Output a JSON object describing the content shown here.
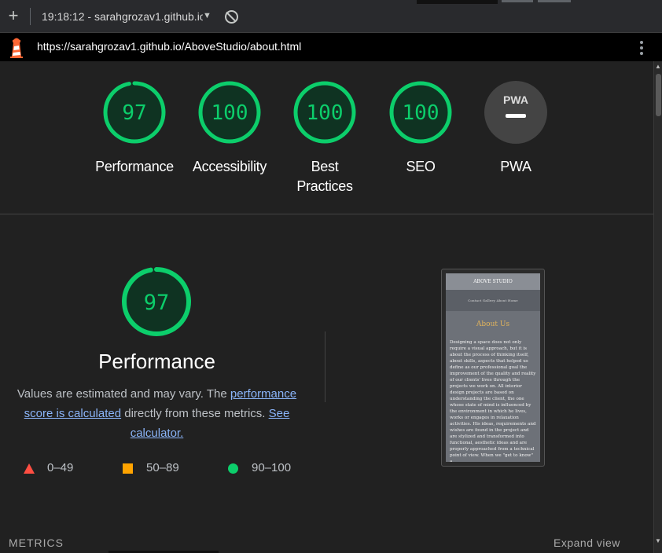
{
  "toolbar": {
    "report_selector": "19:18:12 - sarahgrozav1.github.io",
    "new_report_glyph": "+",
    "clear_glyph": "block-icon"
  },
  "urlbar": {
    "url": "https://sarahgrozav1.github.io/AboveStudio/about.html"
  },
  "gauges": [
    {
      "label": "Performance",
      "score": "97",
      "fraction": 0.97
    },
    {
      "label": "Accessibility",
      "score": "100",
      "fraction": 1.0
    },
    {
      "label": "Best Practices",
      "score": "100",
      "fraction": 1.0
    },
    {
      "label": "SEO",
      "score": "100",
      "fraction": 1.0
    },
    {
      "label": "PWA",
      "score": "PWA",
      "fraction": 0
    }
  ],
  "performance": {
    "score": "97",
    "fraction": 0.97,
    "title": "Performance",
    "desc_pre": "Values are estimated and may vary. The ",
    "link1": "performance score is calculated",
    "desc_mid": " directly from these metrics. ",
    "link2": "See calculator."
  },
  "legend": [
    {
      "range": "0–49",
      "shape": "triangle",
      "color": "#ff4e42"
    },
    {
      "range": "50–89",
      "shape": "square",
      "color": "#ffa400"
    },
    {
      "range": "90–100",
      "shape": "circle",
      "color": "#0cce6b"
    }
  ],
  "preview": {
    "brand": "ABOVE STUDIO",
    "nav": "Contact   Gallery   About   Home",
    "heading": "About Us",
    "body": "Designing a space does not only require a visual approach, but it is about the process of thinking itself, about skills, aspects that helped us define as our professional goal the improvement of the quality and reality of our clients' lives through the projects we work on. All interior design projects are based on understanding the client, the one whose state of mind is influenced by the environment in which he lives, works or engages in relaxation activities. His ideas, requirements and wishes are found in the project and are stylized and transformed into functional, aesthetic ideas and are properly approached from a technical point of view. When we \"get to know\" a"
  },
  "sections": {
    "metrics_label": "METRICS",
    "expand_label": "Expand view"
  },
  "colors": {
    "pass": "#0cce6b",
    "pass_bg": "#0f3322",
    "link": "#8ab4f8"
  }
}
